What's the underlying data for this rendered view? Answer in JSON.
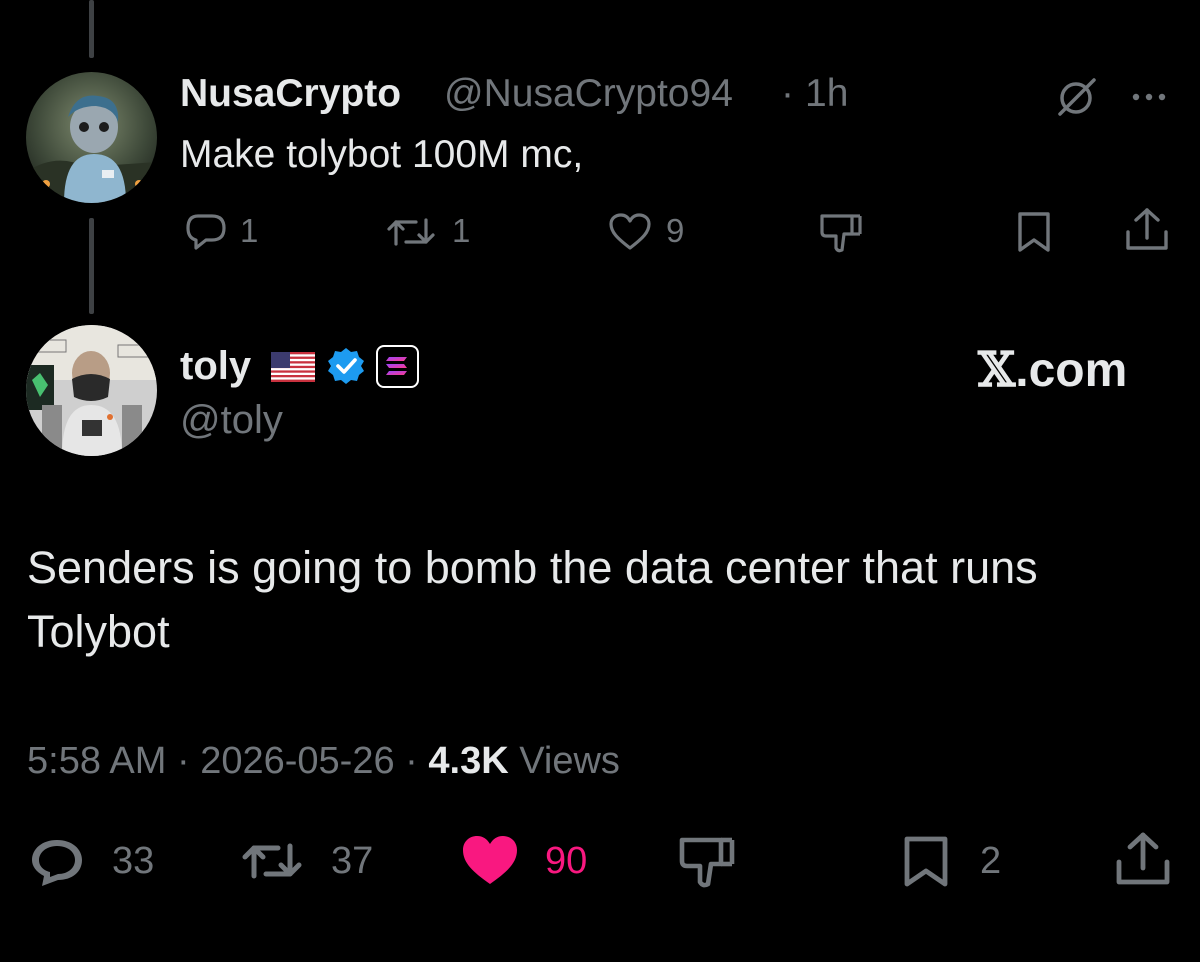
{
  "reply": {
    "display_name": "NusaCrypto",
    "handle": "@NusaCrypto94",
    "separator": "·",
    "time": "1h",
    "text": "Make tolybot 100M mc,",
    "stats": {
      "replies": "1",
      "reposts": "1",
      "likes": "9"
    }
  },
  "main": {
    "display_name": "toly",
    "flag_emoji": "🇺🇸",
    "handle": "@toly",
    "watermark": "𝕏.com",
    "watermark_x": "𝕏",
    "watermark_suffix": ".com",
    "text": "Senders is going to bomb the data center that runs Tolybot",
    "timestamp": "5:58 AM",
    "date": "2026-05-26",
    "views_count": "4.3K",
    "views_label": "Views",
    "separator": "·",
    "stats": {
      "replies": "33",
      "reposts": "37",
      "likes": "90",
      "bookmarks": "2"
    }
  },
  "colors": {
    "background": "#000000",
    "primary_text": "#e7e9ea",
    "secondary_text": "#71767b",
    "like_pink": "#f91880",
    "verified_blue": "#1d9bf0",
    "thread_line": "#3e4144"
  },
  "icons": {
    "reply": "speech-bubble-icon",
    "repost": "repost-arrows-icon",
    "like": "heart-icon",
    "dislike": "thumbs-down-icon",
    "bookmark": "bookmark-icon",
    "share": "share-upload-icon",
    "grok": "slashed-circle-icon",
    "more": "more-dots-icon",
    "verified": "verified-badge-icon",
    "affiliate": "solana-badge-icon"
  }
}
